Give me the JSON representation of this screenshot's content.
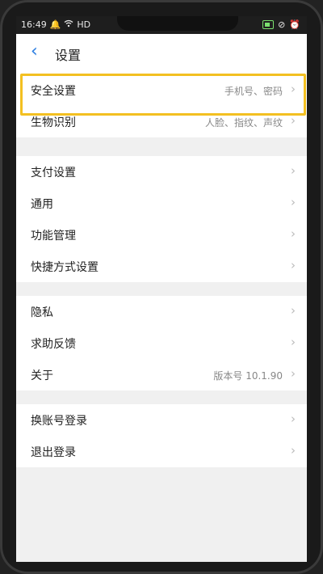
{
  "status_bar": {
    "time": "16:49",
    "network": "HD"
  },
  "header": {
    "title": "设置"
  },
  "groups": [
    [
      {
        "label": "安全设置",
        "value": "手机号、密码"
      },
      {
        "label": "生物识别",
        "value": "人脸、指纹、声纹"
      }
    ],
    [
      {
        "label": "支付设置",
        "value": ""
      },
      {
        "label": "通用",
        "value": ""
      },
      {
        "label": "功能管理",
        "value": ""
      },
      {
        "label": "快捷方式设置",
        "value": ""
      }
    ],
    [
      {
        "label": "隐私",
        "value": ""
      },
      {
        "label": "求助反馈",
        "value": ""
      },
      {
        "label": "关于",
        "value": "版本号 10.1.90"
      }
    ],
    [
      {
        "label": "换账号登录",
        "value": ""
      },
      {
        "label": "退出登录",
        "value": ""
      }
    ]
  ],
  "colors": {
    "accent": "#2a7de1",
    "highlight": "#f3c021"
  }
}
